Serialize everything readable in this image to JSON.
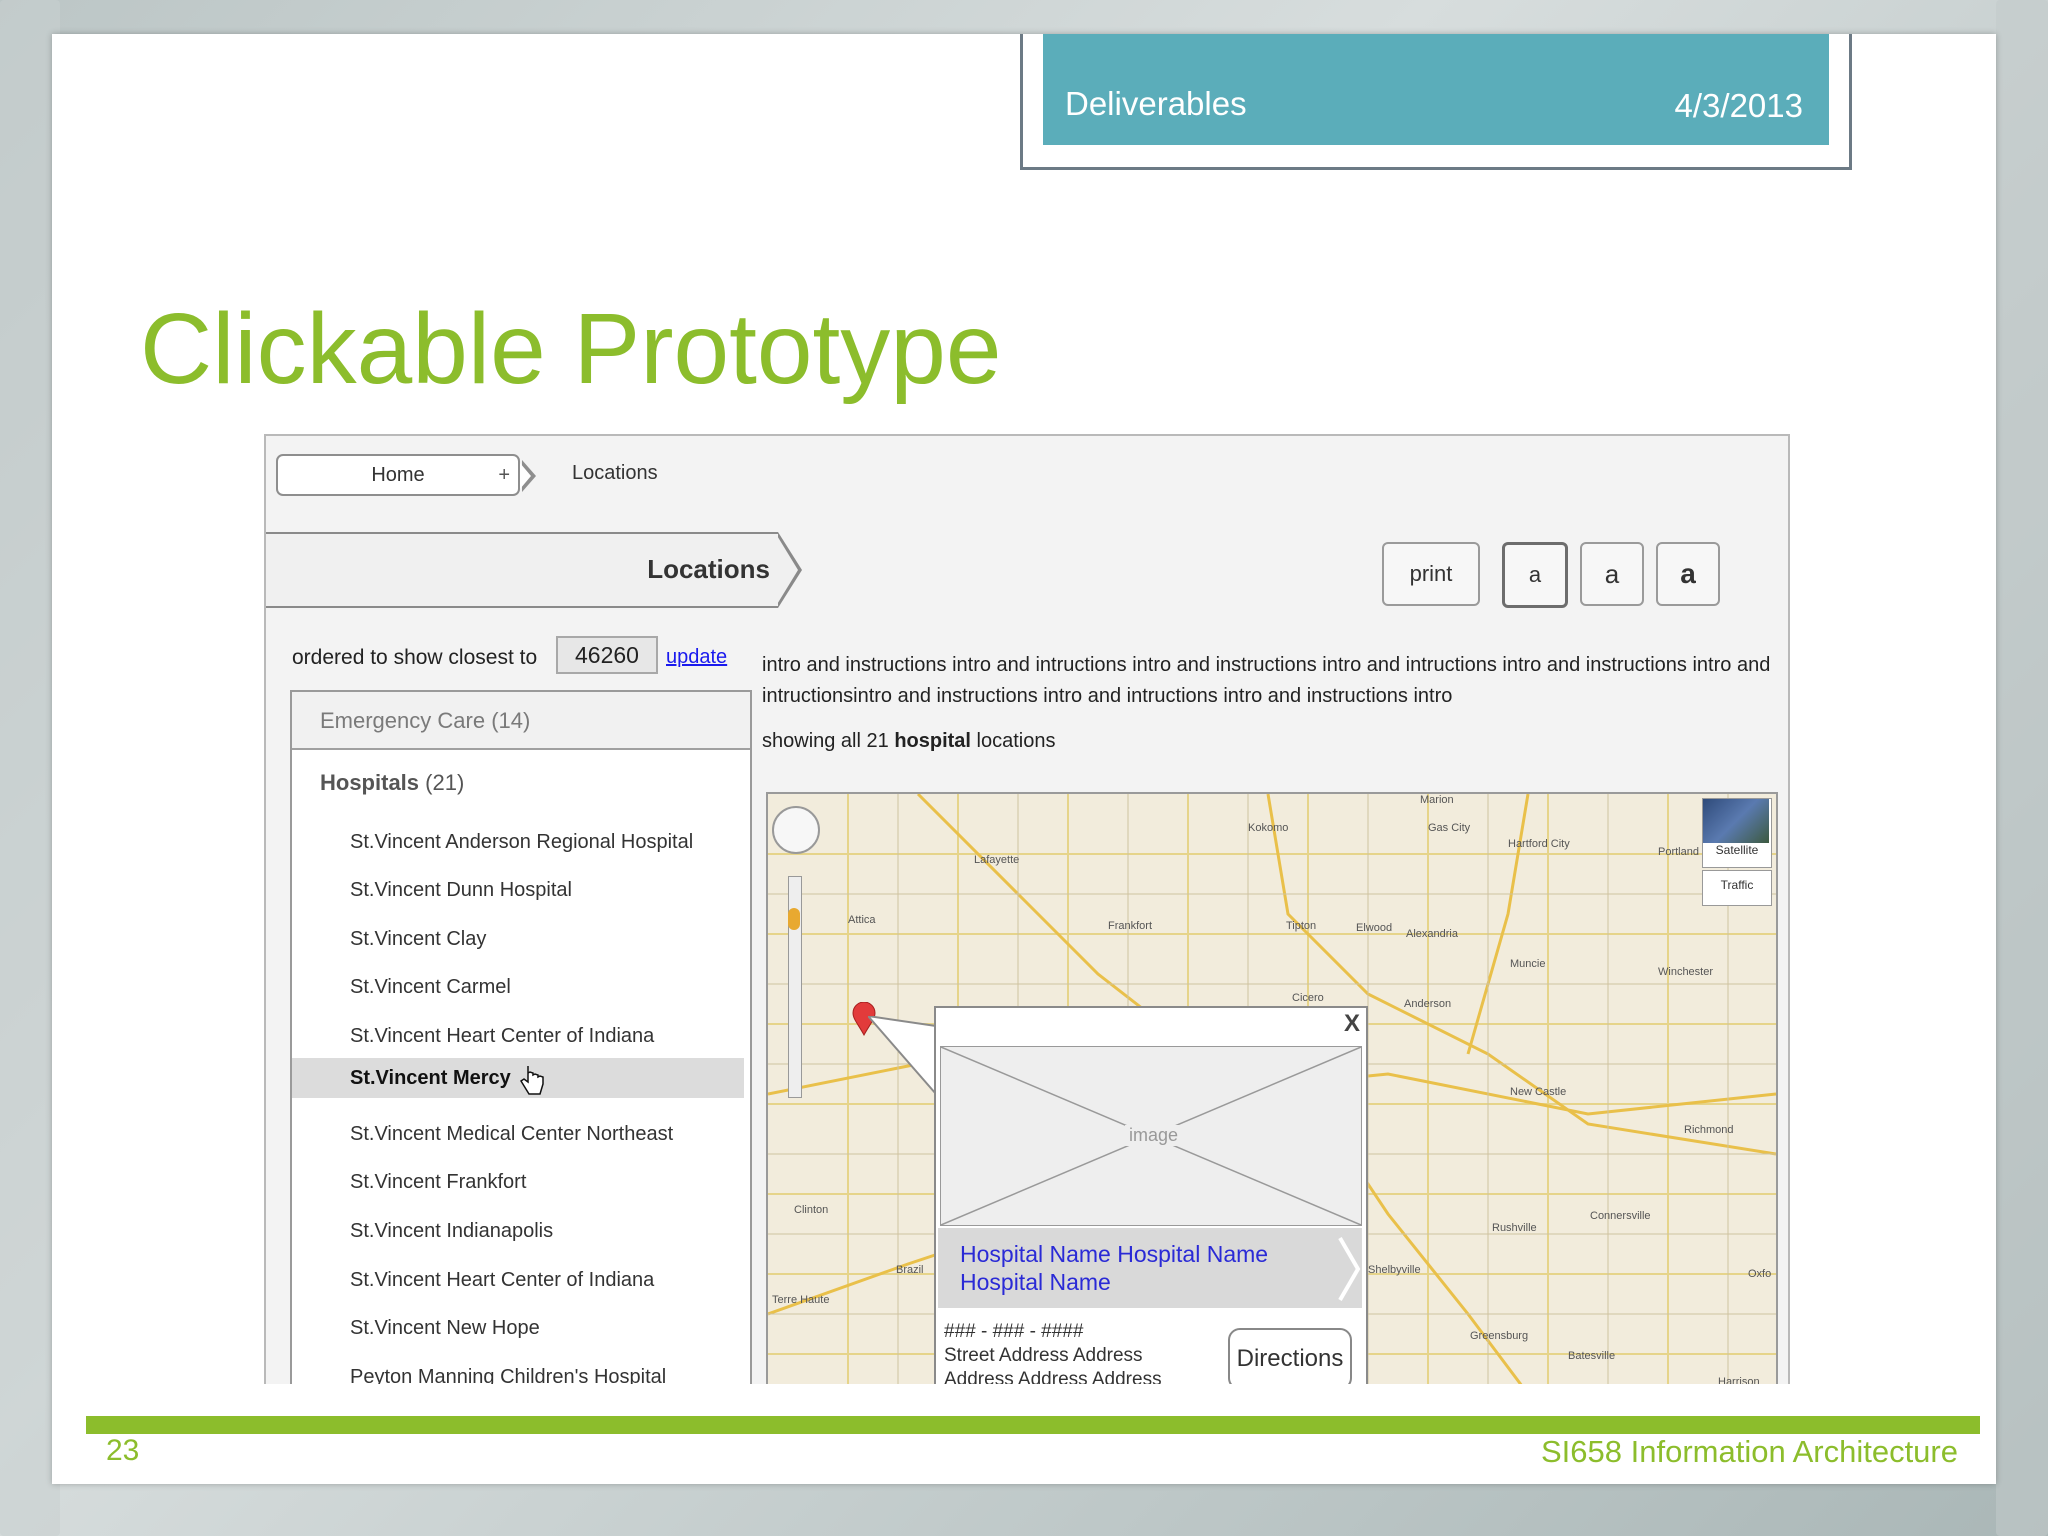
{
  "header": {
    "section": "Deliverables",
    "date": "4/3/2013"
  },
  "slide_title": "Clickable Prototype",
  "breadcrumb": {
    "home": "Home",
    "plus": "+",
    "current": "Locations"
  },
  "page_heading": "Locations",
  "toolbar": {
    "print": "print",
    "font_small": "a",
    "font_medium": "a",
    "font_large": "a"
  },
  "zip": {
    "label": "ordered to show closest to",
    "value": "46260",
    "update": "update"
  },
  "categories": {
    "emergency": {
      "label": "Emergency Care",
      "count": "(14)"
    },
    "hospitals": {
      "label": "Hospitals",
      "count": "(21)"
    }
  },
  "hospital_list": [
    "St.Vincent Anderson Regional Hospital",
    "St.Vincent Dunn Hospital",
    "St.Vincent Clay",
    "St.Vincent Carmel",
    "St.Vincent Heart Center of Indiana",
    "St.Vincent Mercy",
    "St.Vincent Medical Center Northeast",
    "St.Vincent Frankfort",
    "St.Vincent Indianapolis",
    "St.Vincent Heart Center of Indiana",
    "St.Vincent New Hope",
    "Peyton Manning Children's Hospital"
  ],
  "intro_text": "intro and instructions intro and intructions intro and instructions intro and intructions intro and instructions intro and intructionsintro and instructions intro and intructions intro and instructions intro",
  "showing": {
    "prefix": "showing all 21",
    "keyword": "hospital",
    "suffix": "locations"
  },
  "map": {
    "satellite": "Satellite",
    "traffic": "Traffic",
    "towns": [
      "Marion",
      "Kokomo",
      "Gas City",
      "Hartford City",
      "Portland",
      "Lafayette",
      "Frankfort",
      "Tipton",
      "Elwood",
      "Alexandria",
      "Muncie",
      "Winchester",
      "Attica",
      "Cicero",
      "Anderson",
      "New Castle",
      "Richmond",
      "Clinton",
      "Brazil",
      "Terre Haute",
      "Shelbyville",
      "Rushville",
      "Connersville",
      "Greensburg",
      "Batesville",
      "Oxfo",
      "Harrison"
    ],
    "popup": {
      "close": "X",
      "image_label": "image",
      "name": "Hospital Name Hospital Name Hospital Name",
      "phone": "### - ### - ####",
      "address_line1": "Street Address Address",
      "address_line2": "Address Address Address",
      "directions": "Directions"
    }
  },
  "footer": {
    "page_number": "23",
    "course": "SI658 Information Architecture"
  },
  "colors": {
    "accent_green": "#8cbd2c",
    "header_teal": "#5badba",
    "link_blue": "#1a1aee"
  }
}
